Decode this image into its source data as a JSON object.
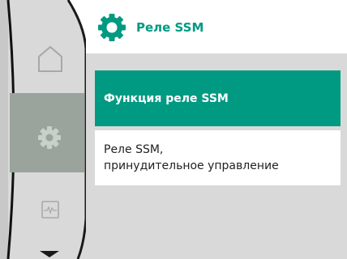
{
  "header": {
    "title": "Реле SSM",
    "icon": "gear-icon"
  },
  "rail": {
    "items": [
      {
        "name": "home",
        "icon": "home-icon",
        "active": false
      },
      {
        "name": "settings",
        "icon": "gear-icon",
        "active": true
      },
      {
        "name": "diagnostics",
        "icon": "pulse-icon",
        "active": false
      }
    ],
    "scroll_icon": "chevron-down-icon"
  },
  "menu": {
    "items": [
      {
        "label": "Функция реле SSM",
        "selected": true
      },
      {
        "label_line1": "Реле SSM,",
        "label_line2": "принудительное управление",
        "selected": false
      }
    ]
  },
  "colors": {
    "accent": "#009a82",
    "background": "#d9d9d9",
    "rail_active": "#9aa49c"
  }
}
